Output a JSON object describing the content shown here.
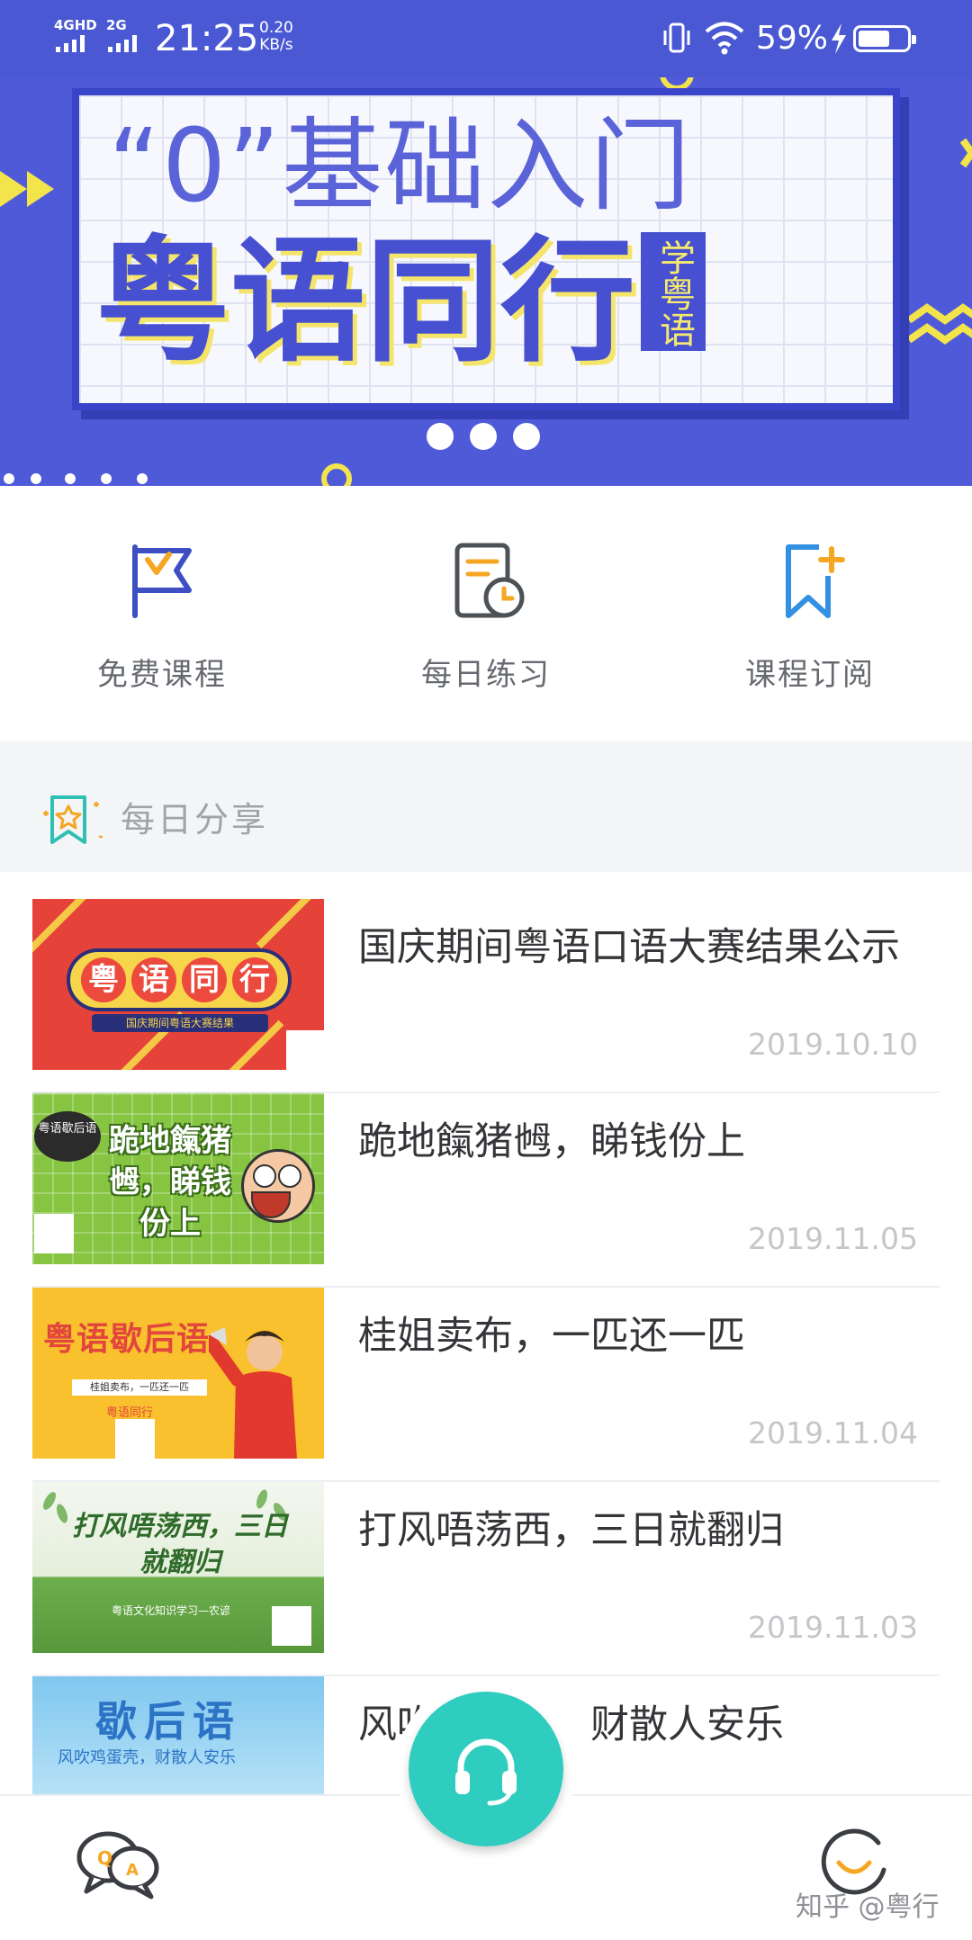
{
  "status_bar": {
    "network_1": "4GHD",
    "network_2": "2G",
    "time": "21:25",
    "speed_value": "0.20",
    "speed_unit": "KB/s",
    "battery": "59%"
  },
  "banner": {
    "subtitle": "“0”基础入门",
    "title": "粤语同行",
    "tag": "学粤语",
    "page_count": 3
  },
  "quick_menu": [
    {
      "label": "免费课程",
      "icon": "flag-icon"
    },
    {
      "label": "每日练习",
      "icon": "clipboard-clock-icon"
    },
    {
      "label": "课程订阅",
      "icon": "bookmark-plus-icon"
    }
  ],
  "section": {
    "title": "每日分享"
  },
  "articles": [
    {
      "title": "国庆期间粤语口语大赛结果公示",
      "date": "2019.10.10",
      "thumb": {
        "chars": [
          "粤",
          "语",
          "同",
          "行"
        ],
        "sub": "国庆期间粤语大赛结果"
      }
    },
    {
      "title": "跪地餼猪乸，睇钱份上",
      "date": "2019.11.05",
      "thumb": {
        "badge": "粤语歇后语",
        "text": "跪地餼猪乸，睇钱份上"
      }
    },
    {
      "title": "桂姐卖布，一匹还一匹",
      "date": "2019.11.04",
      "thumb": {
        "head": "粤语歇后语",
        "strip": "桂姐卖布，一匹还一匹",
        "brand": "粤语同行"
      }
    },
    {
      "title": "打风唔荡西，三日就翻归",
      "date": "2019.11.03",
      "thumb": {
        "head": "打风唔荡西，三日就翻归",
        "caption": "粤语文化知识学习—农谚"
      }
    },
    {
      "title": "风吹鸡蛋壳，财散人安乐",
      "date": "",
      "thumb": {
        "head": "歇后语",
        "sub": "风吹鸡蛋壳，财散人安乐"
      }
    }
  ],
  "bottom_nav": {
    "left_icon": "qa-chat-icon",
    "center_icon": "headphones-icon",
    "right_icon": "profile-icon"
  },
  "watermark": "知乎 @粤行",
  "colors": {
    "status_bar": "#4a59d3",
    "banner": "#4f5ad9",
    "accent_teal": "#2fcdbf",
    "accent_orange": "#f5a623",
    "icon_blue": "#3e4fc4"
  }
}
